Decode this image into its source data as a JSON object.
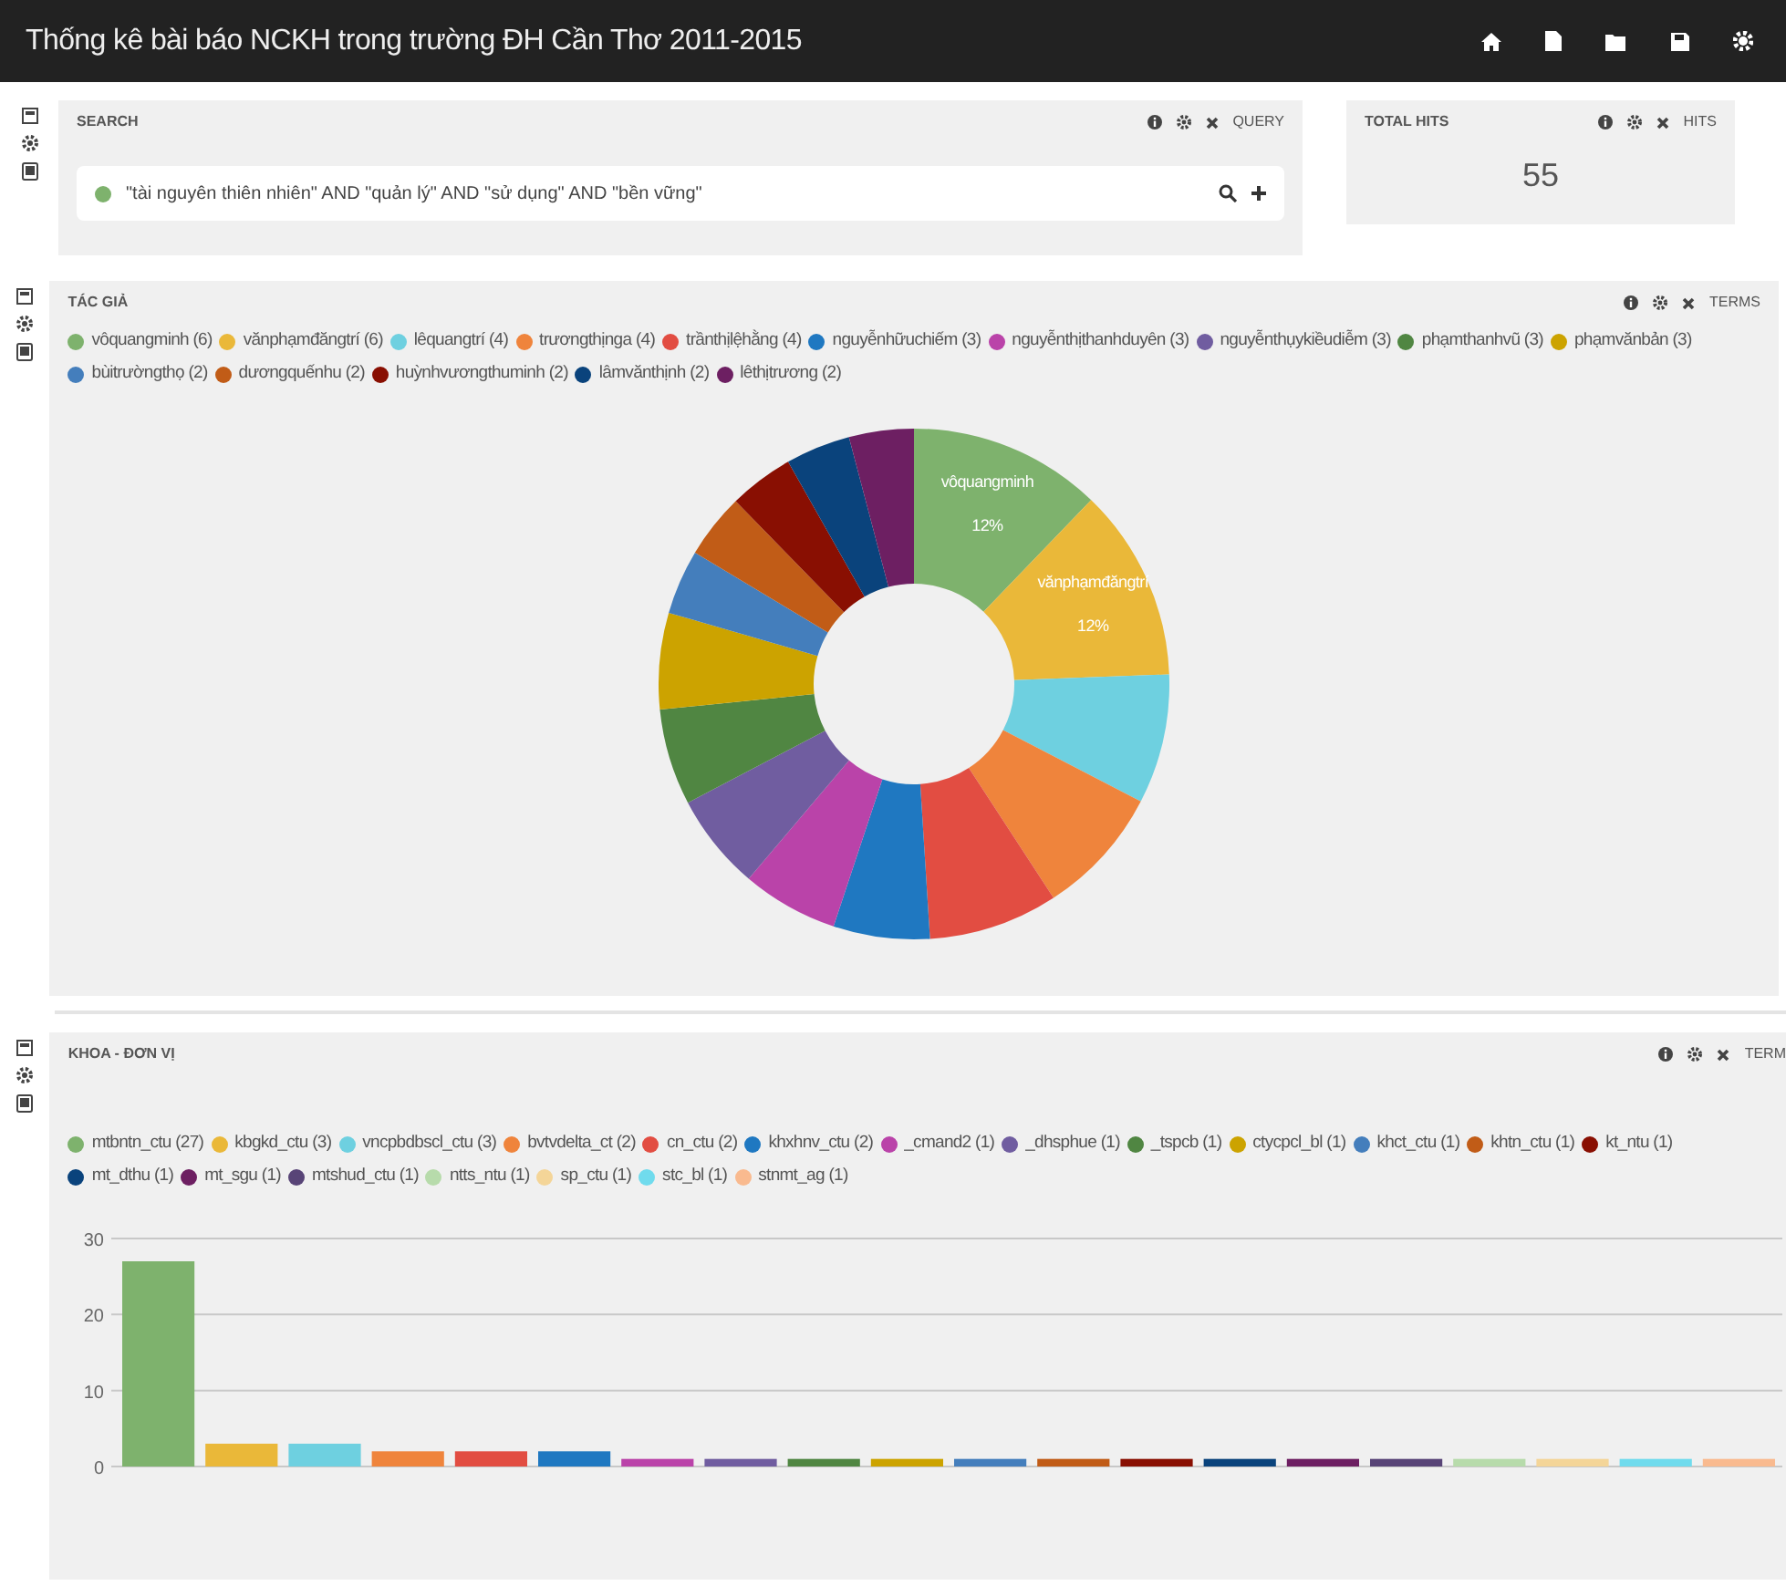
{
  "navbar": {
    "title": "Thống kê bài báo NCKH trong trường ĐH Cần Thơ 2011-2015"
  },
  "query_panel": {
    "title": "SEARCH",
    "type_label": "QUERY",
    "query": {
      "text": "\"tài nguyên thiên nhiên\" AND \"quản lý\" AND \"sử dụng\" AND \"bền vững\"",
      "color": "#7eb26d"
    }
  },
  "hits_panel": {
    "title": "TOTAL HITS",
    "type_label": "HITS",
    "value": "55"
  },
  "author_panel": {
    "title": "TÁC GIẢ",
    "type_label": "TERMS",
    "legend": [
      {
        "label": "vôquangminh (6)",
        "color": "#7eb26d"
      },
      {
        "label": "vănphạmđăngtrí (6)",
        "color": "#eab839"
      },
      {
        "label": "lêquangtrí (4)",
        "color": "#6ed0e0"
      },
      {
        "label": "trươngthịnga (4)",
        "color": "#ef843c"
      },
      {
        "label": "trầnthịlệhằng (4)",
        "color": "#e24d42"
      },
      {
        "label": "nguyễnhữuchiếm (3)",
        "color": "#1f78c1"
      },
      {
        "label": "nguyễnthịthanhduyên (3)",
        "color": "#ba43a9"
      },
      {
        "label": "nguyễnthụykiềudiễm (3)",
        "color": "#705da0"
      },
      {
        "label": "phạmthanhvũ (3)",
        "color": "#508642"
      },
      {
        "label": "phạmvănbản (3)",
        "color": "#cca300"
      },
      {
        "label": "bùitrườngthọ (2)",
        "color": "#447ebc"
      },
      {
        "label": "dươngquếnhu (2)",
        "color": "#c15c17"
      },
      {
        "label": "huỳnhvươngthuminh (2)",
        "color": "#890f02"
      },
      {
        "label": "lâmvănthịnh (2)",
        "color": "#0a437c"
      },
      {
        "label": "lêthịtrương (2)",
        "color": "#6d1f62"
      }
    ],
    "slice_labels": [
      {
        "name": "vôquangminh",
        "value": "12%"
      },
      {
        "name": "vănphạmđăngtrí",
        "value": "12%"
      }
    ],
    "chart_data": {
      "type": "donut",
      "values": [
        12.2,
        12.2,
        8.2,
        8.2,
        8.2,
        6.1,
        6.1,
        6.1,
        6.1,
        6.1,
        4.1,
        4.1,
        4.1,
        4.1,
        4.1
      ]
    }
  },
  "unit_panel": {
    "title": "KHOA - ĐƠN VỊ",
    "type_label": "TERM",
    "legend": [
      {
        "label": "mtbntn_ctu (27)",
        "color": "#7eb26d"
      },
      {
        "label": "kbgkd_ctu (3)",
        "color": "#eab839"
      },
      {
        "label": "vncpbdbscl_ctu (3)",
        "color": "#6ed0e0"
      },
      {
        "label": "bvtvdelta_ct (2)",
        "color": "#ef843c"
      },
      {
        "label": "cn_ctu (2)",
        "color": "#e24d42"
      },
      {
        "label": "khxhnv_ctu (2)",
        "color": "#1f78c1"
      },
      {
        "label": "_cmand2 (1)",
        "color": "#ba43a9"
      },
      {
        "label": "_dhsphue (1)",
        "color": "#705da0"
      },
      {
        "label": "_tspcb (1)",
        "color": "#508642"
      },
      {
        "label": "ctycpcl_bl (1)",
        "color": "#cca300"
      },
      {
        "label": "khct_ctu (1)",
        "color": "#447ebc"
      },
      {
        "label": "khtn_ctu (1)",
        "color": "#c15c17"
      },
      {
        "label": "kt_ntu (1)",
        "color": "#890f02"
      },
      {
        "label": "mt_dthu (1)",
        "color": "#0a437c"
      },
      {
        "label": "mt_sgu (1)",
        "color": "#6d1f62"
      },
      {
        "label": "mtshud_ctu (1)",
        "color": "#584477"
      },
      {
        "label": "ntts_ntu (1)",
        "color": "#b7dbab"
      },
      {
        "label": "sp_ctu (1)",
        "color": "#f4d598"
      },
      {
        "label": "stc_bl (1)",
        "color": "#70dbed"
      },
      {
        "label": "stnmt_ag (1)",
        "color": "#f9ba8f"
      }
    ],
    "chart_data": {
      "type": "bar",
      "values": [
        27,
        3,
        3,
        2,
        2,
        2,
        1,
        1,
        1,
        1,
        1,
        1,
        1,
        1,
        1,
        1,
        1,
        1,
        1,
        1
      ],
      "ylim": [
        0,
        30
      ],
      "yticks": [
        0,
        10,
        20,
        30
      ]
    }
  }
}
